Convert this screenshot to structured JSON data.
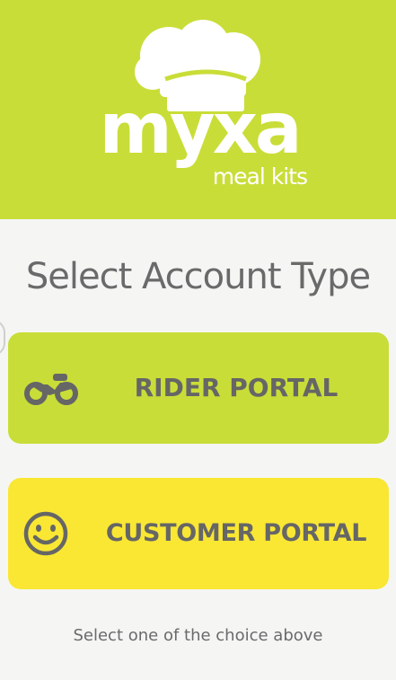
{
  "header": {
    "logo_icon": "chef-hat-icon",
    "brand_name": "myxa",
    "brand_tagline": "meal kits"
  },
  "title": "Select Account Type",
  "portals": {
    "rider": {
      "label": "RIDER PORTAL",
      "icon": "motorcycle-icon"
    },
    "customer": {
      "label": "CUSTOMER PORTAL",
      "icon": "smiley-face-icon"
    }
  },
  "hint": "Select one of the choice above",
  "colors": {
    "header_bg": "#c9dd38",
    "rider_bg": "#c9dd38",
    "customer_bg": "#f9e733",
    "text_gray": "#666666",
    "page_bg": "#f5f6f4"
  }
}
